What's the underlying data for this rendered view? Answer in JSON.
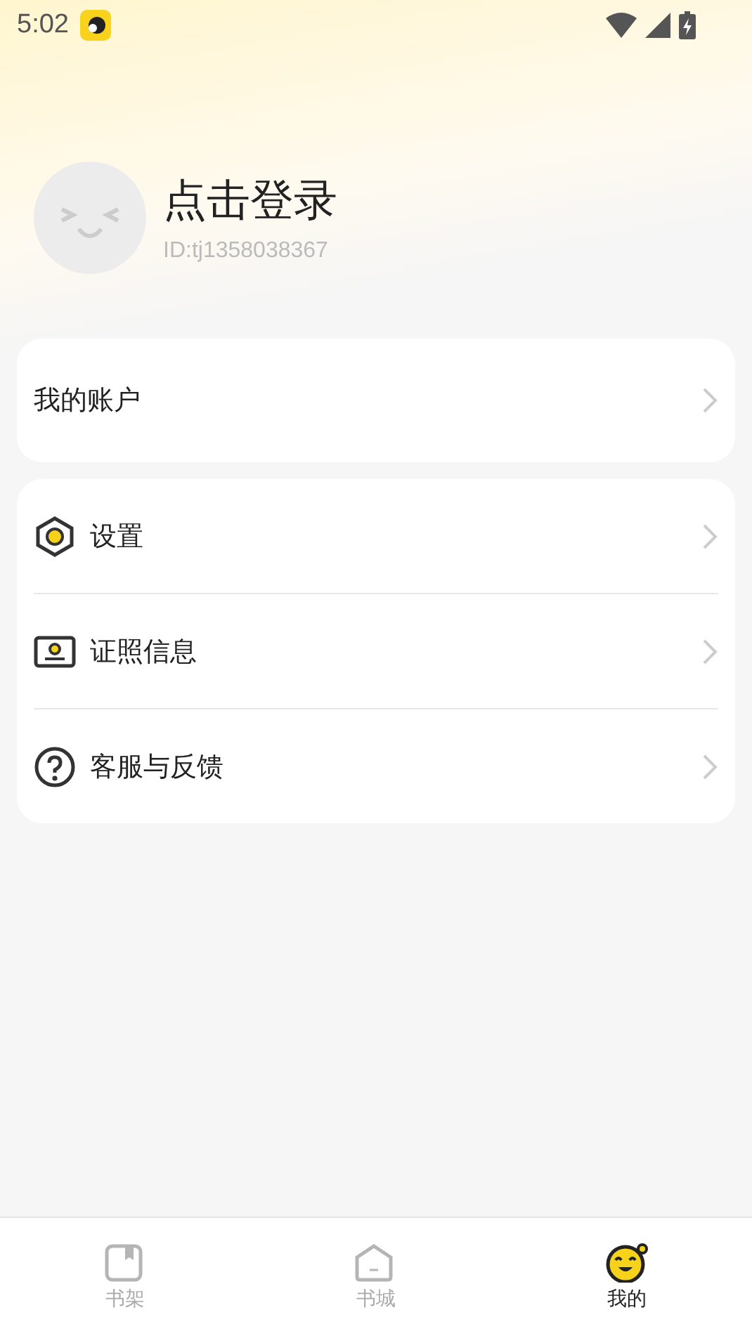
{
  "status_bar": {
    "time": "5:02"
  },
  "profile": {
    "name": "点击登录",
    "id": "ID:tj1358038367"
  },
  "account": {
    "label": "我的账户"
  },
  "menu": [
    {
      "kind": "settings",
      "label": "设置"
    },
    {
      "kind": "license",
      "label": "证照信息"
    },
    {
      "kind": "help",
      "label": "客服与反馈"
    }
  ],
  "tabs": [
    {
      "kind": "shelf",
      "label": "书架",
      "selected": false
    },
    {
      "kind": "store",
      "label": "书城",
      "selected": false
    },
    {
      "kind": "me",
      "label": "我的",
      "selected": true
    }
  ]
}
